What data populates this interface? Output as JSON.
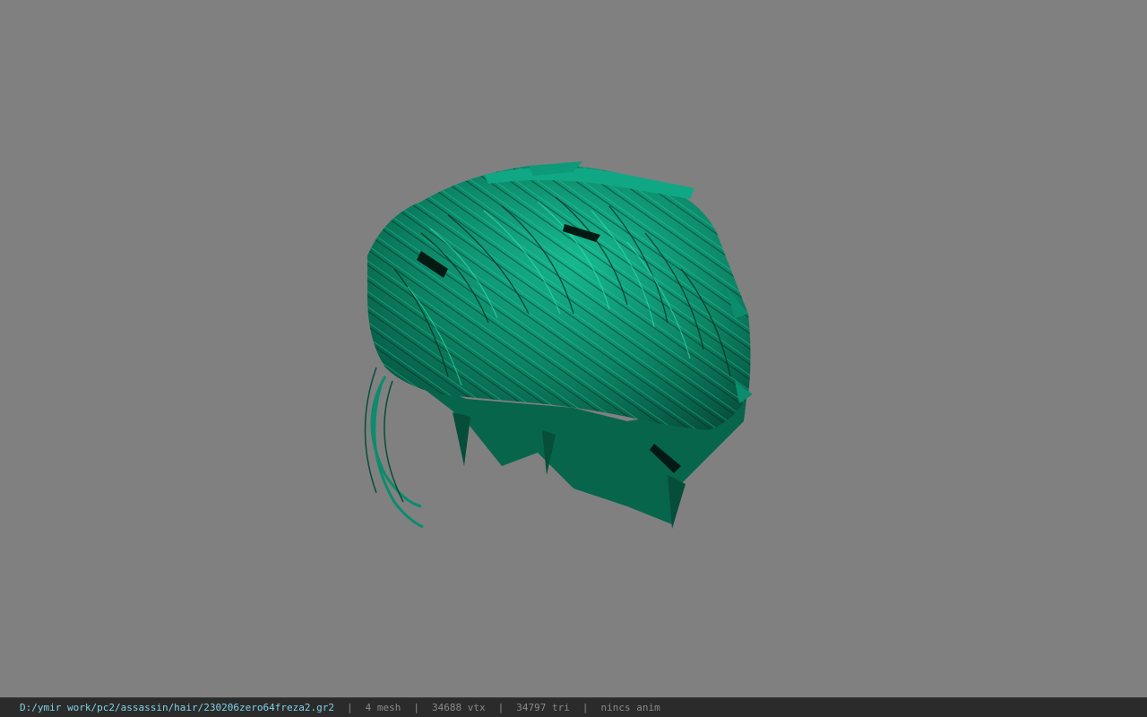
{
  "viewport": {
    "background_color": "#808080",
    "model": {
      "name": "hair-mesh",
      "base_color": "#0a7a5e",
      "highlight_color": "#1fd6a8",
      "shadow_color": "#03261c"
    }
  },
  "status_bar": {
    "file_path": "D:/ymir work/pc2/assassin/hair/230206zero64freza2.gr2",
    "separator": "|",
    "mesh_count": "4 mesh",
    "vertex_count": "34688 vtx",
    "triangle_count": "34797 tri",
    "anim_status": "nincs anim",
    "path_color": "#7fd4e6",
    "stat_color": "#8a8a8a"
  }
}
